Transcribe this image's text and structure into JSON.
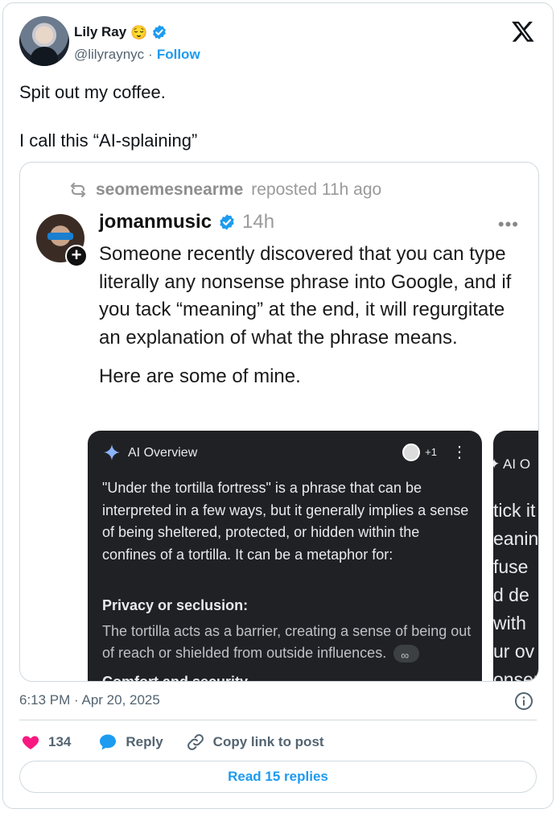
{
  "author": {
    "name": "Lily Ray",
    "emoji": "😌",
    "handle": "@lilyraynyc",
    "separator": "·",
    "follow_label": "Follow"
  },
  "tweet": {
    "line1": "Spit out my coffee.",
    "line2": "I call this “AI-splaining”"
  },
  "embedded_post": {
    "repost_user": "seomemesnearme",
    "repost_label": "reposted 11h ago",
    "user": "jomanmusic",
    "time": "14h",
    "more": "•••",
    "paragraph1": "Someone recently discovered that you can type literally any nonsense phrase into Google, and if you tack “meaning” at the end, it will regurgitate an explanation of what the phrase means.",
    "paragraph2": "Here are some of mine.",
    "ai_overview": {
      "title": "AI Overview",
      "source_count": "+1",
      "body": "\"Under the tortilla fortress\" is a phrase that can be interpreted in a few ways, but it generally implies a sense of being sheltered, protected, or hidden within the confines of a tortilla. It can be a metaphor for:",
      "subheading": "Privacy or seclusion:",
      "subtext": "The tortilla acts as a barrier, creating a sense of being out of reach or shielded from outside influences.",
      "cut_text": "Comfort and security"
    },
    "ai_overview_peek": {
      "title": "AI O",
      "lines": [
        "tick it",
        "eanin",
        "fuse",
        "d de",
        "with",
        "ur ov",
        "onser"
      ]
    }
  },
  "footer": {
    "timestamp": "6:13 PM · Apr 20, 2025",
    "likes": "134",
    "reply_label": "Reply",
    "copy_label": "Copy link to post",
    "read_replies": "Read 15 replies"
  },
  "colors": {
    "accent": "#1d9bf0",
    "like": "#f91880",
    "muted": "#536471",
    "border": "#cfd9de",
    "ai_bg": "#202124"
  }
}
